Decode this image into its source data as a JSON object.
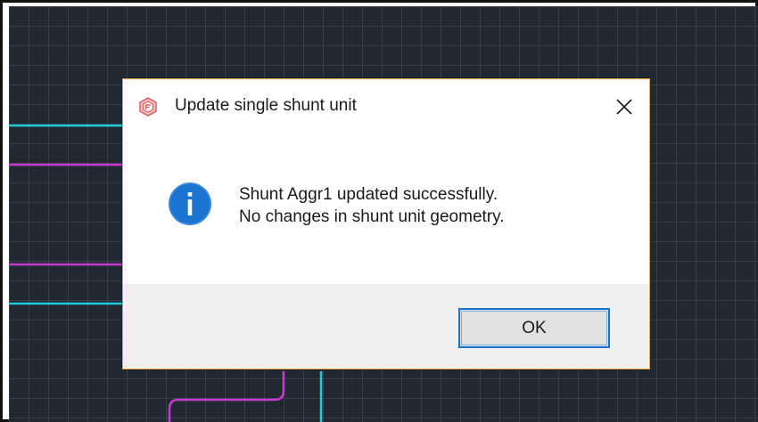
{
  "background": {
    "app": "CAD drawing canvas",
    "grid_color": "#465260",
    "line_colors": [
      "#1ecbd6",
      "#c83ad0"
    ]
  },
  "dialog": {
    "title": "Update single shunt unit",
    "app_icon": "app-logo-icon",
    "close_icon": "close-icon",
    "message_icon": "info-icon",
    "message_lines": [
      "Shunt Aggr1 updated successfully.",
      "No changes in shunt unit geometry."
    ],
    "ok_label": "OK",
    "accent_color": "#e8a43a",
    "button_focus_color": "#1a73c8"
  }
}
